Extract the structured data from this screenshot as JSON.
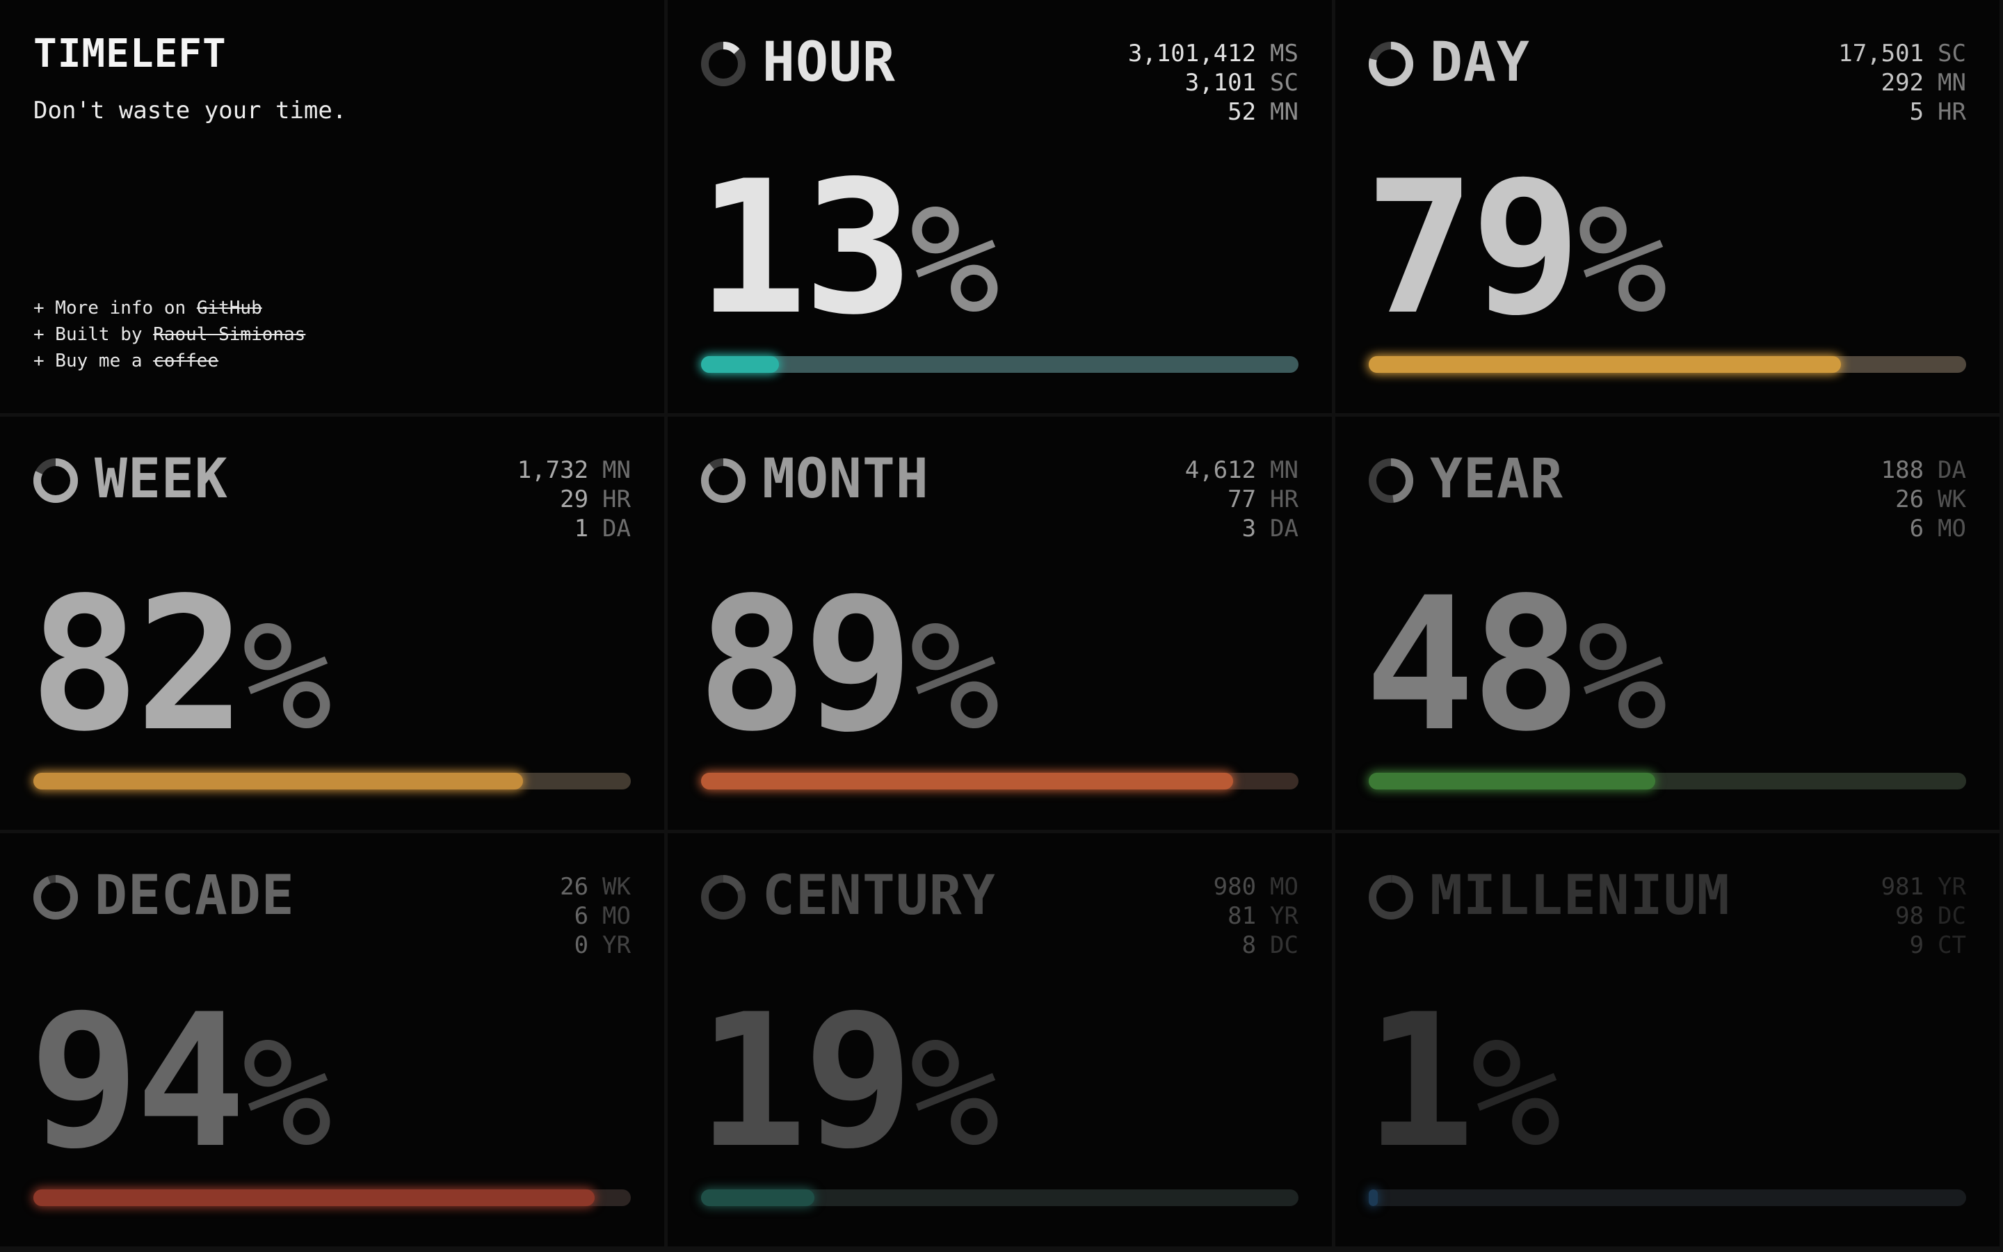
{
  "app": {
    "title": "TIMELEFT",
    "tagline": "Don't waste your time.",
    "links": [
      {
        "prefix": "+ More info on ",
        "link": "GitHub"
      },
      {
        "prefix": "+ Built by ",
        "link": "Raoul Simionas"
      },
      {
        "prefix": "+ Buy me a ",
        "link": "coffee"
      }
    ]
  },
  "cards": [
    {
      "key": "hour",
      "label": "HOUR",
      "percent": 13,
      "percent_text": "13",
      "suffix": "%",
      "color": "#2ab2a5",
      "track_color": "#3d5b5c",
      "label_color": "#e3e3e3",
      "muted_color": "#8d8d8d",
      "stats": [
        {
          "value": "3,101,412",
          "unit": "MS"
        },
        {
          "value": "3,101",
          "unit": "SC"
        },
        {
          "value": "52",
          "unit": "MN"
        }
      ]
    },
    {
      "key": "day",
      "label": "DAY",
      "percent": 79,
      "percent_text": "79",
      "suffix": "%",
      "color": "#d09a3d",
      "track_color": "#51483d",
      "label_color": "#c6c6c6",
      "muted_color": "#7a7a7a",
      "stats": [
        {
          "value": "17,501",
          "unit": "SC"
        },
        {
          "value": "292",
          "unit": "MN"
        },
        {
          "value": "5",
          "unit": "HR"
        }
      ]
    },
    {
      "key": "week",
      "label": "WEEK",
      "percent": 82,
      "percent_text": "82",
      "suffix": "%",
      "color": "#c58d3b",
      "track_color": "#433b31",
      "label_color": "#ababab",
      "muted_color": "#6e6e6e",
      "stats": [
        {
          "value": "1,732",
          "unit": "MN"
        },
        {
          "value": "29",
          "unit": "HR"
        },
        {
          "value": "1",
          "unit": "DA"
        }
      ]
    },
    {
      "key": "month",
      "label": "MONTH",
      "percent": 89,
      "percent_text": "89",
      "suffix": "%",
      "color": "#ba5a34",
      "track_color": "#3a2c26",
      "label_color": "#9b9b9b",
      "muted_color": "#5f5f5f",
      "stats": [
        {
          "value": "4,612",
          "unit": "MN"
        },
        {
          "value": "77",
          "unit": "HR"
        },
        {
          "value": "3",
          "unit": "DA"
        }
      ]
    },
    {
      "key": "year",
      "label": "YEAR",
      "percent": 48,
      "percent_text": "48",
      "suffix": "%",
      "color": "#3c7a35",
      "track_color": "#283026",
      "label_color": "#7d7d7d",
      "muted_color": "#525252",
      "stats": [
        {
          "value": "188",
          "unit": "DA"
        },
        {
          "value": "26",
          "unit": "WK"
        },
        {
          "value": "6",
          "unit": "MO"
        }
      ]
    },
    {
      "key": "decade",
      "label": "DECADE",
      "percent": 94,
      "percent_text": "94",
      "suffix": "%",
      "color": "#8e3829",
      "track_color": "#2d2523",
      "label_color": "#666666",
      "muted_color": "#434343",
      "stats": [
        {
          "value": "26",
          "unit": "WK"
        },
        {
          "value": "6",
          "unit": "MO"
        },
        {
          "value": "0",
          "unit": "YR"
        }
      ]
    },
    {
      "key": "century",
      "label": "CENTURY",
      "percent": 19,
      "percent_text": "19",
      "suffix": "%",
      "color": "#1f4f47",
      "track_color": "#1d2322",
      "label_color": "#4b4b4b",
      "muted_color": "#333333",
      "stats": [
        {
          "value": "980",
          "unit": "MO"
        },
        {
          "value": "81",
          "unit": "YR"
        },
        {
          "value": "8",
          "unit": "DC"
        }
      ]
    },
    {
      "key": "millenium",
      "label": "MILLENIUM",
      "percent": 1,
      "percent_text": "1",
      "suffix": "%",
      "color": "#1c3a55",
      "track_color": "#181b1e",
      "label_color": "#333333",
      "muted_color": "#262626",
      "stats": [
        {
          "value": "981",
          "unit": "YR"
        },
        {
          "value": "98",
          "unit": "DC"
        },
        {
          "value": "9",
          "unit": "CT"
        }
      ]
    }
  ]
}
